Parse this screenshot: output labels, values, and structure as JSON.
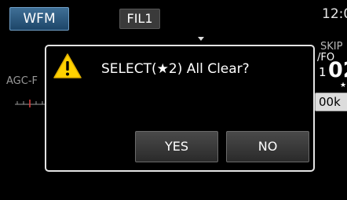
{
  "header": {
    "mode_label": "WFM",
    "filter_label": "FIL1",
    "clock": "12:0"
  },
  "left": {
    "agc_label": "AGC-F"
  },
  "right": {
    "skip_label": "SKIP",
    "fo_label": "/FO",
    "freq_prefix": "1",
    "freq_digits": "02",
    "freq_star": "★",
    "step_value": "00k"
  },
  "dialog": {
    "message": "SELECT(★2) All Clear?",
    "yes_label": "YES",
    "no_label": "NO"
  },
  "colors": {
    "mode_button": "#2f5d86",
    "warning_icon": "#ffd200",
    "background": "#000000"
  }
}
